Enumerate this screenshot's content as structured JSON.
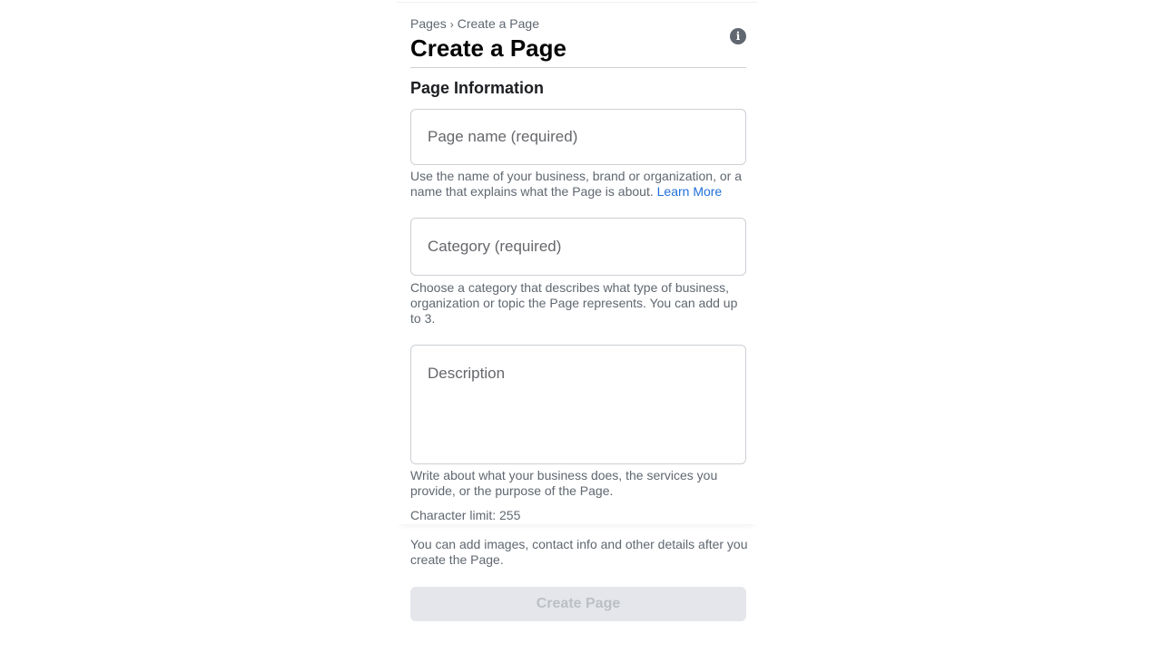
{
  "breadcrumb": {
    "parent": "Pages",
    "separator": "›",
    "current": "Create a Page"
  },
  "header": {
    "title": "Create a Page",
    "info_icon": "info-icon"
  },
  "section": {
    "title": "Page Information"
  },
  "fields": {
    "page_name": {
      "placeholder": "Page name (required)",
      "value": "",
      "help": "Use the name of your business, brand or organization, or a name that explains what the Page is about.",
      "help_link": "Learn More"
    },
    "category": {
      "placeholder": "Category (required)",
      "value": "",
      "help": "Choose a category that describes what type of business, organization or topic the Page represents. You can add up to 3."
    },
    "description": {
      "placeholder": "Description",
      "value": "",
      "help": "Write about what your business does, the services you provide, or the purpose of the Page.",
      "char_limit": "Character limit: 255"
    }
  },
  "footer": {
    "note": "You can add images, contact info and other details after you create the Page.",
    "create_button": "Create Page"
  },
  "colors": {
    "link": "#216fdb",
    "button_disabled_bg": "#e4e6eb",
    "button_disabled_text": "#bcc0c4",
    "help_text": "#606770"
  }
}
